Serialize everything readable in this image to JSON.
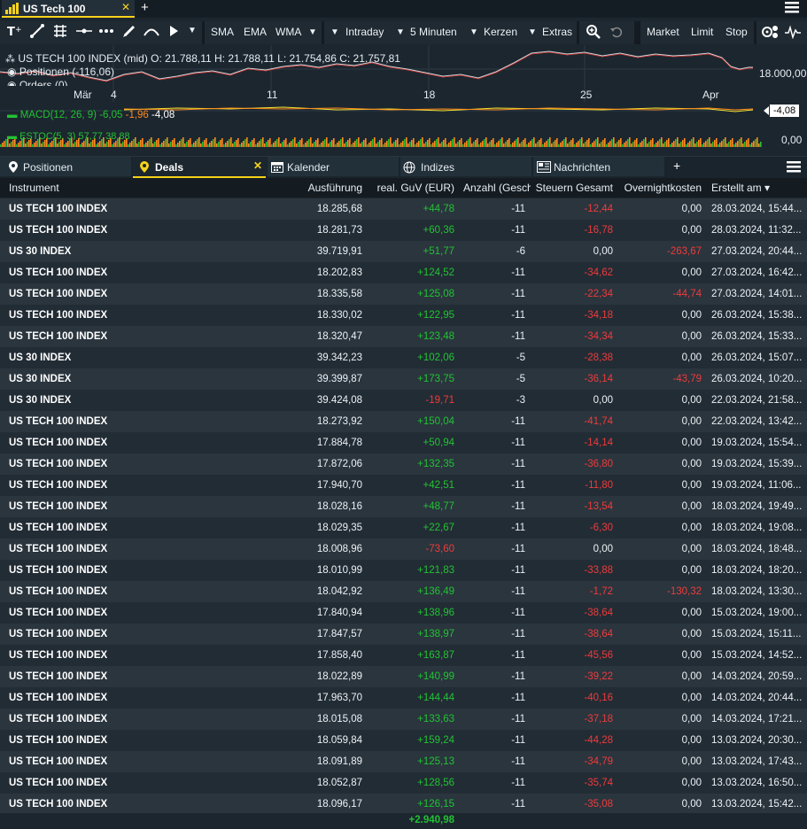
{
  "top_tab": {
    "title": "US Tech 100",
    "close_icon": "✕",
    "add_label": "+"
  },
  "toolbar": {
    "ma_buttons": [
      "SMA",
      "EMA",
      "WMA"
    ],
    "interval": "Intraday",
    "period": "5 Minuten",
    "chart_type": "Kerzen",
    "extras": "Extras",
    "orders": [
      "Market",
      "Limit",
      "Stop"
    ]
  },
  "chart": {
    "instrument_line": "US TECH 100 INDEX (mid)  O: 21.788,11  H: 21.788,11  L: 21.754,86  C: 21.757,81",
    "positions_line": "Positionen (-116,06)",
    "orders_line": "Orders (0)",
    "x_labels": [
      "Mär",
      "4",
      "11",
      "18",
      "25",
      "Apr"
    ],
    "price_level": "18.000,00",
    "macd_label": "MACD(12, 26, 9)",
    "macd_v1": "-6,05",
    "macd_v2": "-1,96",
    "macd_v3": "-4,08",
    "macd_tag": "-4,08",
    "stoch_label": "ESTOC(5, 3)  57,77  38,88",
    "stoch_value": "0,00"
  },
  "panel_tabs": {
    "positions": "Positionen",
    "deals": "Deals",
    "calendar": "Kalender",
    "indices": "Indizes",
    "news": "Nachrichten",
    "add": "+"
  },
  "table": {
    "headers": {
      "instrument": "Instrument",
      "execution": "Ausführung",
      "pnl": "real. GuV (EUR)",
      "qty": "Anzahl (Geschl",
      "taxes": "Steuern Gesamt",
      "overnight": "Overnightkosten",
      "created": "Erstellt am ▾"
    },
    "rows": [
      {
        "inst": "US TECH 100 INDEX",
        "exec": "18.285,68",
        "pnl": "+44,78",
        "qty": "-11",
        "tax": "-12,44",
        "on": "0,00",
        "date": "28.03.2024, 15:44..."
      },
      {
        "inst": "US TECH 100 INDEX",
        "exec": "18.281,73",
        "pnl": "+60,36",
        "qty": "-11",
        "tax": "-16,78",
        "on": "0,00",
        "date": "28.03.2024, 11:32..."
      },
      {
        "inst": "US 30 INDEX",
        "exec": "39.719,91",
        "pnl": "+51,77",
        "qty": "-6",
        "tax": "0,00",
        "on": "-263,67",
        "date": "27.03.2024, 20:44..."
      },
      {
        "inst": "US TECH 100 INDEX",
        "exec": "18.202,83",
        "pnl": "+124,52",
        "qty": "-11",
        "tax": "-34,62",
        "on": "0,00",
        "date": "27.03.2024, 16:42..."
      },
      {
        "inst": "US TECH 100 INDEX",
        "exec": "18.335,58",
        "pnl": "+125,08",
        "qty": "-11",
        "tax": "-22,34",
        "on": "-44,74",
        "date": "27.03.2024, 14:01..."
      },
      {
        "inst": "US TECH 100 INDEX",
        "exec": "18.330,02",
        "pnl": "+122,95",
        "qty": "-11",
        "tax": "-34,18",
        "on": "0,00",
        "date": "26.03.2024, 15:38..."
      },
      {
        "inst": "US TECH 100 INDEX",
        "exec": "18.320,47",
        "pnl": "+123,48",
        "qty": "-11",
        "tax": "-34,34",
        "on": "0,00",
        "date": "26.03.2024, 15:33..."
      },
      {
        "inst": "US 30 INDEX",
        "exec": "39.342,23",
        "pnl": "+102,06",
        "qty": "-5",
        "tax": "-28,38",
        "on": "0,00",
        "date": "26.03.2024, 15:07..."
      },
      {
        "inst": "US 30 INDEX",
        "exec": "39.399,87",
        "pnl": "+173,75",
        "qty": "-5",
        "tax": "-36,14",
        "on": "-43,79",
        "date": "26.03.2024, 10:20..."
      },
      {
        "inst": "US 30 INDEX",
        "exec": "39.424,08",
        "pnl": "-19,71",
        "qty": "-3",
        "tax": "0,00",
        "on": "0,00",
        "date": "22.03.2024, 21:58..."
      },
      {
        "inst": "US TECH 100 INDEX",
        "exec": "18.273,92",
        "pnl": "+150,04",
        "qty": "-11",
        "tax": "-41,74",
        "on": "0,00",
        "date": "22.03.2024, 13:42..."
      },
      {
        "inst": "US TECH 100 INDEX",
        "exec": "17.884,78",
        "pnl": "+50,94",
        "qty": "-11",
        "tax": "-14,14",
        "on": "0,00",
        "date": "19.03.2024, 15:54..."
      },
      {
        "inst": "US TECH 100 INDEX",
        "exec": "17.872,06",
        "pnl": "+132,35",
        "qty": "-11",
        "tax": "-36,80",
        "on": "0,00",
        "date": "19.03.2024, 15:39..."
      },
      {
        "inst": "US TECH 100 INDEX",
        "exec": "17.940,70",
        "pnl": "+42,51",
        "qty": "-11",
        "tax": "-11,80",
        "on": "0,00",
        "date": "19.03.2024, 11:06..."
      },
      {
        "inst": "US TECH 100 INDEX",
        "exec": "18.028,16",
        "pnl": "+48,77",
        "qty": "-11",
        "tax": "-13,54",
        "on": "0,00",
        "date": "18.03.2024, 19:49..."
      },
      {
        "inst": "US TECH 100 INDEX",
        "exec": "18.029,35",
        "pnl": "+22,67",
        "qty": "-11",
        "tax": "-6,30",
        "on": "0,00",
        "date": "18.03.2024, 19:08..."
      },
      {
        "inst": "US TECH 100 INDEX",
        "exec": "18.008,96",
        "pnl": "-73,60",
        "qty": "-11",
        "tax": "0,00",
        "on": "0,00",
        "date": "18.03.2024, 18:48..."
      },
      {
        "inst": "US TECH 100 INDEX",
        "exec": "18.010,99",
        "pnl": "+121,83",
        "qty": "-11",
        "tax": "-33,88",
        "on": "0,00",
        "date": "18.03.2024, 18:20..."
      },
      {
        "inst": "US TECH 100 INDEX",
        "exec": "18.042,92",
        "pnl": "+136,49",
        "qty": "-11",
        "tax": "-1,72",
        "on": "-130,32",
        "date": "18.03.2024, 13:30..."
      },
      {
        "inst": "US TECH 100 INDEX",
        "exec": "17.840,94",
        "pnl": "+138,96",
        "qty": "-11",
        "tax": "-38,64",
        "on": "0,00",
        "date": "15.03.2024, 19:00..."
      },
      {
        "inst": "US TECH 100 INDEX",
        "exec": "17.847,57",
        "pnl": "+138,97",
        "qty": "-11",
        "tax": "-38,64",
        "on": "0,00",
        "date": "15.03.2024, 15:11..."
      },
      {
        "inst": "US TECH 100 INDEX",
        "exec": "17.858,40",
        "pnl": "+163,87",
        "qty": "-11",
        "tax": "-45,56",
        "on": "0,00",
        "date": "15.03.2024, 14:52..."
      },
      {
        "inst": "US TECH 100 INDEX",
        "exec": "18.022,89",
        "pnl": "+140,99",
        "qty": "-11",
        "tax": "-39,22",
        "on": "0,00",
        "date": "14.03.2024, 20:59..."
      },
      {
        "inst": "US TECH 100 INDEX",
        "exec": "17.963,70",
        "pnl": "+144,44",
        "qty": "-11",
        "tax": "-40,16",
        "on": "0,00",
        "date": "14.03.2024, 20:44..."
      },
      {
        "inst": "US TECH 100 INDEX",
        "exec": "18.015,08",
        "pnl": "+133,63",
        "qty": "-11",
        "tax": "-37,18",
        "on": "0,00",
        "date": "14.03.2024, 17:21..."
      },
      {
        "inst": "US TECH 100 INDEX",
        "exec": "18.059,84",
        "pnl": "+159,24",
        "qty": "-11",
        "tax": "-44,28",
        "on": "0,00",
        "date": "13.03.2024, 20:30..."
      },
      {
        "inst": "US TECH 100 INDEX",
        "exec": "18.091,89",
        "pnl": "+125,13",
        "qty": "-11",
        "tax": "-34,79",
        "on": "0,00",
        "date": "13.03.2024, 17:43..."
      },
      {
        "inst": "US TECH 100 INDEX",
        "exec": "18.052,87",
        "pnl": "+128,56",
        "qty": "-11",
        "tax": "-35,74",
        "on": "0,00",
        "date": "13.03.2024, 16:50..."
      },
      {
        "inst": "US TECH 100 INDEX",
        "exec": "18.096,17",
        "pnl": "+126,15",
        "qty": "-11",
        "tax": "-35,08",
        "on": "0,00",
        "date": "13.03.2024, 15:42..."
      }
    ],
    "total_pnl": "+2.940,98"
  },
  "colors": {
    "positive": "#22c233",
    "negative": "#ef3b3b",
    "accent": "#f6d21b"
  }
}
